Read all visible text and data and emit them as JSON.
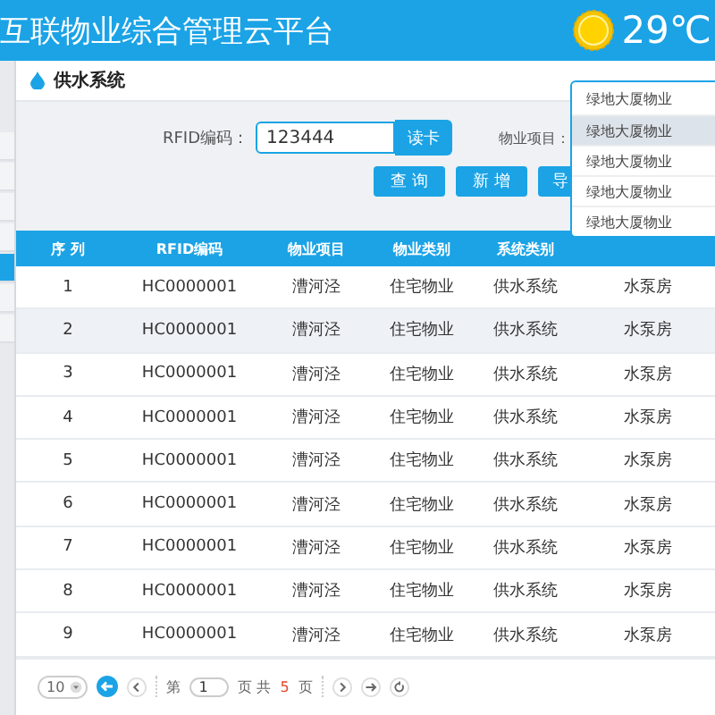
{
  "header": {
    "title": "互联物业综合管理云平台",
    "temperature": "29℃"
  },
  "sidebar": {
    "items": [
      {
        "selected": false
      },
      {
        "selected": false
      },
      {
        "selected": false
      },
      {
        "selected": false
      },
      {
        "selected": true
      },
      {
        "selected": false
      },
      {
        "selected": false
      }
    ]
  },
  "tab": {
    "label": "供水系统"
  },
  "form": {
    "rfid_label": "RFID编码：",
    "rfid_value": "123444",
    "read_button": "读卡",
    "project_label": "物业项目：",
    "project_select": {
      "value": "绿地大厦物业",
      "expanded": true,
      "options": [
        {
          "label": "绿地大厦物业",
          "highlighted": true
        },
        {
          "label": "绿地大厦物业",
          "highlighted": false
        },
        {
          "label": "绿地大厦物业",
          "highlighted": false
        },
        {
          "label": "绿地大厦物业",
          "highlighted": false
        }
      ]
    },
    "buttons": [
      "查 询",
      "新 增",
      "导"
    ]
  },
  "table": {
    "columns": [
      "序 列",
      "RFID编码",
      "物业项目",
      "物业类别",
      "系统类别"
    ],
    "rows": [
      {
        "cells": [
          "1",
          "HC0000001",
          "漕河泾",
          "住宅物业",
          "供水系统",
          "水泵房"
        ],
        "selected": false
      },
      {
        "cells": [
          "2",
          "HC0000001",
          "漕河泾",
          "住宅物业",
          "供水系统",
          "水泵房"
        ],
        "selected": true
      },
      {
        "cells": [
          "3",
          "HC0000001",
          "漕河泾",
          "住宅物业",
          "供水系统",
          "水泵房"
        ],
        "selected": false
      },
      {
        "cells": [
          "4",
          "HC0000001",
          "漕河泾",
          "住宅物业",
          "供水系统",
          "水泵房"
        ],
        "selected": false
      },
      {
        "cells": [
          "5",
          "HC0000001",
          "漕河泾",
          "住宅物业",
          "供水系统",
          "水泵房"
        ],
        "selected": false
      },
      {
        "cells": [
          "6",
          "HC0000001",
          "漕河泾",
          "住宅物业",
          "供水系统",
          "水泵房"
        ],
        "selected": false
      },
      {
        "cells": [
          "7",
          "HC0000001",
          "漕河泾",
          "住宅物业",
          "供水系统",
          "水泵房"
        ],
        "selected": false
      },
      {
        "cells": [
          "8",
          "HC0000001",
          "漕河泾",
          "住宅物业",
          "供水系统",
          "水泵房"
        ],
        "selected": false
      },
      {
        "cells": [
          "9",
          "HC0000001",
          "漕河泾",
          "住宅物业",
          "供水系统",
          "水泵房"
        ],
        "selected": false
      }
    ]
  },
  "pagination": {
    "page_size": "10",
    "page_prefix": "第",
    "page": "1",
    "page_suffix": "页 共",
    "total": "5",
    "total_suffix": "页"
  }
}
